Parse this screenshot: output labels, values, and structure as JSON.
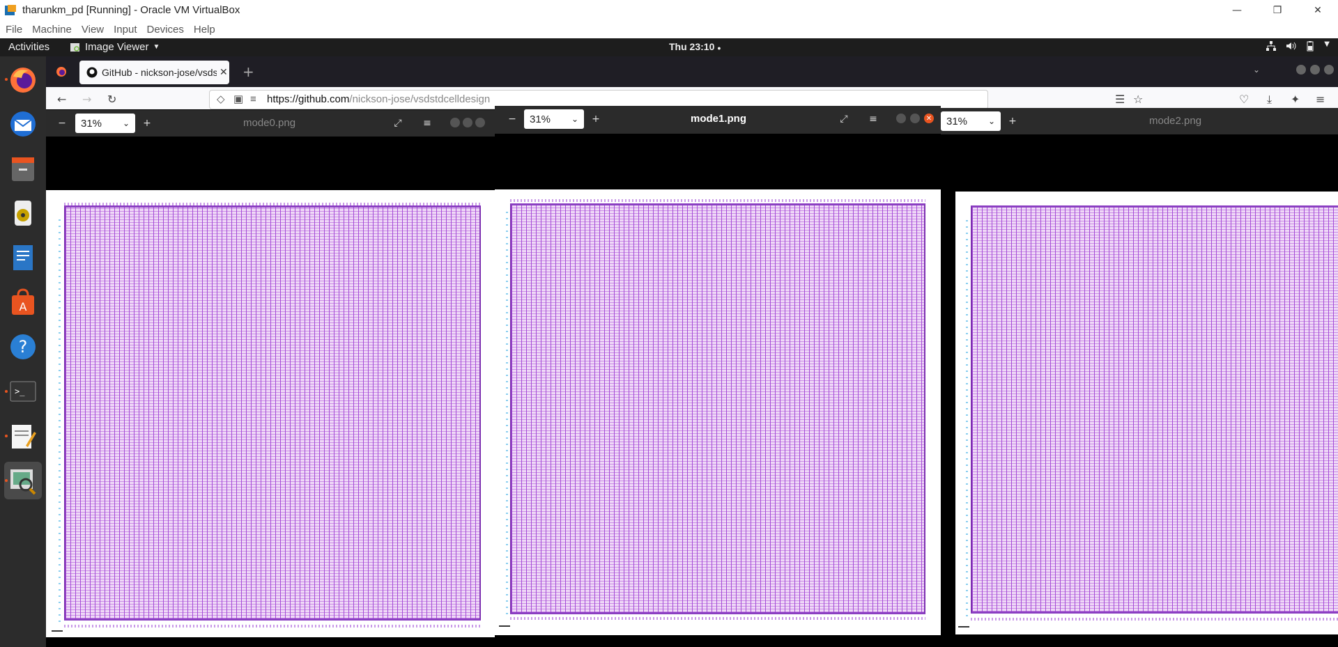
{
  "vbox": {
    "title": "tharunkm_pd [Running] - Oracle VM VirtualBox",
    "menu": [
      "File",
      "Machine",
      "View",
      "Input",
      "Devices",
      "Help"
    ]
  },
  "topbar": {
    "activities": "Activities",
    "app_menu": "Image Viewer",
    "clock": "Thu 23:10"
  },
  "dock": {
    "items": [
      "firefox-icon",
      "thunderbird-icon",
      "files-icon",
      "rhythmbox-icon",
      "writer-icon",
      "software-icon",
      "help-icon",
      "terminal-icon",
      "text-editor-icon",
      "image-viewer-icon"
    ]
  },
  "firefox": {
    "tab_title": "GitHub - nickson-jose/vsdstdcelldesign",
    "url_host": "https://github.com",
    "url_path": "/nickson-jose/vsdstdcelldesign"
  },
  "viewers": [
    {
      "title": "mode0.png",
      "zoom": "31%"
    },
    {
      "title": "mode1.png",
      "zoom": "31%"
    },
    {
      "title": "mode2.png",
      "zoom": "31%"
    }
  ],
  "colors": {
    "accent": "#e95420",
    "layout_purple": "#a44bd6"
  }
}
